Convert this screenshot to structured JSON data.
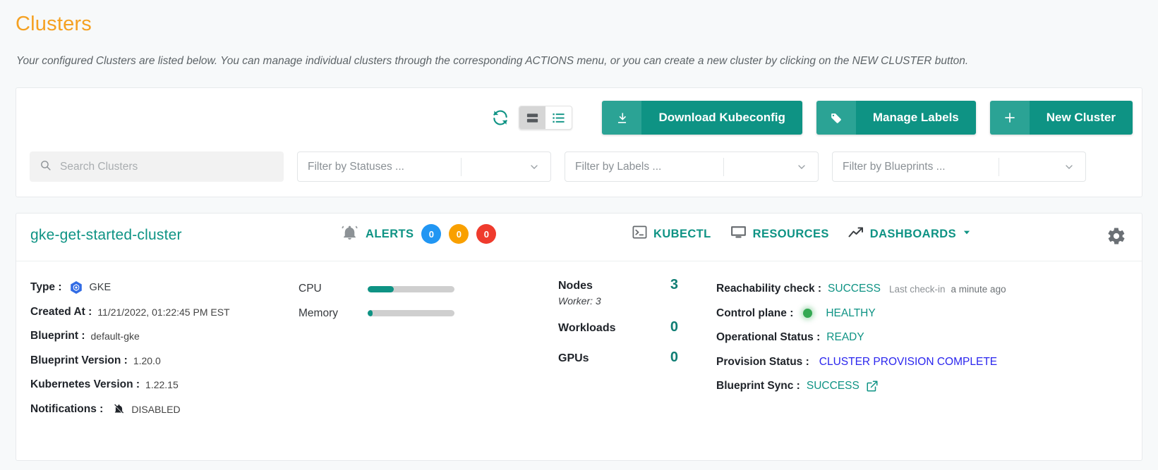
{
  "header": {
    "title": "Clusters",
    "description": "Your configured Clusters are listed below. You can manage individual clusters through the corresponding ACTIONS menu, or you can create a new cluster by clicking on the NEW CLUSTER button."
  },
  "toolbar": {
    "refresh_icon": "refresh-icon",
    "view_card_icon": "card-view-icon",
    "view_list_icon": "list-view-icon",
    "buttons": [
      {
        "label": "Download Kubeconfig",
        "icon": "download-icon"
      },
      {
        "label": "Manage Labels",
        "icon": "tag-icon"
      },
      {
        "label": "New Cluster",
        "icon": "plus-icon"
      }
    ]
  },
  "filters": {
    "search_placeholder": "Search Clusters",
    "search_value": "",
    "statuses": "Filter by Statuses ...",
    "labels": "Filter by Labels ...",
    "blueprints": "Filter by Blueprints ..."
  },
  "cluster": {
    "name": "gke-get-started-cluster",
    "alerts": {
      "label": "ALERTS",
      "badges": [
        {
          "count": "0",
          "color": "#2196f3"
        },
        {
          "count": "0",
          "color": "#f9a000"
        },
        {
          "count": "0",
          "color": "#ef3b2d"
        }
      ]
    },
    "actions": [
      {
        "label": "KUBECTL",
        "icon": "terminal-icon"
      },
      {
        "label": "RESOURCES",
        "icon": "resources-icon"
      },
      {
        "label": "DASHBOARDS",
        "icon": "trending-up-icon"
      }
    ],
    "settings_icon": "gear-icon",
    "details": [
      {
        "key": "Type :",
        "value": "GKE",
        "icon": "kubernetes-gke-icon"
      },
      {
        "key": "Created At :",
        "value": "11/21/2022, 01:22:45 PM EST"
      },
      {
        "key": "Blueprint :",
        "value": "default-gke"
      },
      {
        "key": "Blueprint Version :",
        "value": "1.20.0"
      },
      {
        "key": "Kubernetes Version :",
        "value": "1.22.15"
      },
      {
        "key": "Notifications :",
        "value": "DISABLED",
        "icon": "bell-off-icon"
      }
    ],
    "meters": [
      {
        "label": "CPU",
        "percent": 30
      },
      {
        "label": "Memory",
        "percent": 6
      }
    ],
    "stats": [
      {
        "label": "Nodes",
        "value": "3",
        "sub": "Worker: 3"
      },
      {
        "label": "Workloads",
        "value": "0"
      },
      {
        "label": "GPUs",
        "value": "0"
      }
    ],
    "status": [
      {
        "key": "Reachability check :",
        "value": "SUCCESS",
        "extra_label": "Last check-in",
        "extra_value": "a minute ago"
      },
      {
        "key": "Control plane :",
        "value": "HEALTHY",
        "dot": "#34a853"
      },
      {
        "key": "Operational Status :",
        "value": "READY"
      },
      {
        "key": "Provision Status :",
        "value": "CLUSTER PROVISION COMPLETE",
        "style": "link"
      },
      {
        "key": "Blueprint Sync :",
        "value": "SUCCESS",
        "icon": "external-link-icon"
      }
    ]
  },
  "colors": {
    "accent_teal": "#0e9384",
    "accent_teal_light": "#2ba395",
    "title_orange": "#f5a122",
    "link_blue": "#2a25ee",
    "healthy_green": "#34a853"
  }
}
